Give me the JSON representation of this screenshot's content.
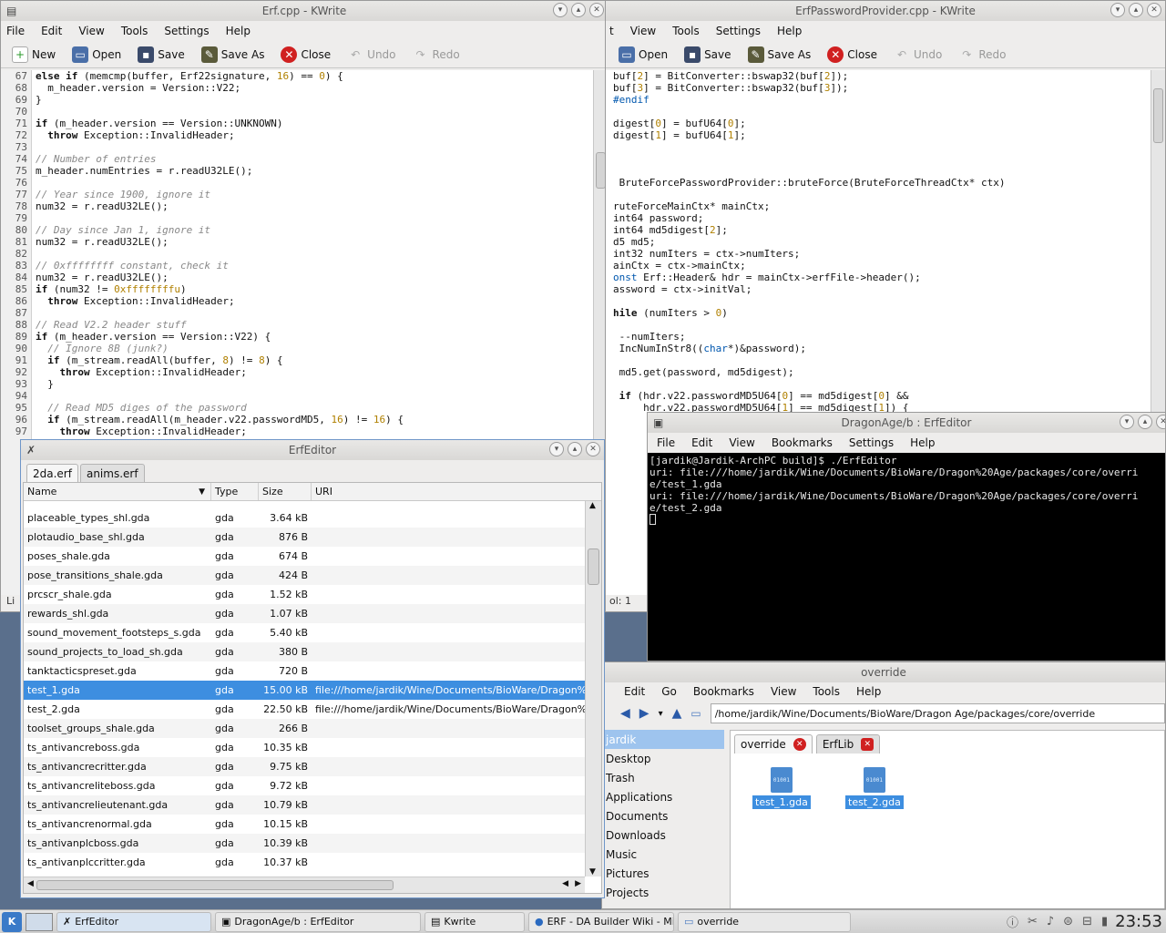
{
  "kwrite_left": {
    "title": "Erf.cpp  - KWrite",
    "menu": [
      "File",
      "Edit",
      "View",
      "Tools",
      "Settings",
      "Help"
    ],
    "toolbar": {
      "new": "New",
      "open": "Open",
      "save": "Save",
      "save_as": "Save As",
      "close": "Close",
      "undo": "Undo",
      "redo": "Redo"
    },
    "line_numbers": [
      "67",
      "68",
      "69",
      "70",
      "71",
      "72",
      "73",
      "74",
      "75",
      "76",
      "77",
      "78",
      "79",
      "80",
      "81",
      "82",
      "83",
      "84",
      "85",
      "86",
      "87",
      "88",
      "89",
      "90",
      "91",
      "92",
      "93",
      "94",
      "95",
      "96",
      "97"
    ],
    "status_prefix": "Li"
  },
  "kwrite_right": {
    "title": "ErfPasswordProvider.cpp  - KWrite",
    "menu": [
      "t",
      "View",
      "Tools",
      "Settings",
      "Help"
    ],
    "toolbar": {
      "open": "Open",
      "save": "Save",
      "save_as": "Save As",
      "close": "Close",
      "undo": "Undo",
      "redo": "Redo"
    },
    "status_col": "ol: 1"
  },
  "erfeditor": {
    "title": "ErfEditor",
    "tabs": [
      "2da.erf",
      "anims.erf"
    ],
    "columns": [
      "Name",
      "Type",
      "Size",
      "URI"
    ],
    "rows": [
      {
        "name": "placeable_types_shl.gda",
        "type": "gda",
        "size": "3.64 kB",
        "uri": ""
      },
      {
        "name": "plotaudio_base_shl.gda",
        "type": "gda",
        "size": "876 B",
        "uri": ""
      },
      {
        "name": "poses_shale.gda",
        "type": "gda",
        "size": "674 B",
        "uri": ""
      },
      {
        "name": "pose_transitions_shale.gda",
        "type": "gda",
        "size": "424 B",
        "uri": ""
      },
      {
        "name": "prcscr_shale.gda",
        "type": "gda",
        "size": "1.52 kB",
        "uri": ""
      },
      {
        "name": "rewards_shl.gda",
        "type": "gda",
        "size": "1.07 kB",
        "uri": ""
      },
      {
        "name": "sound_movement_footsteps_s.gda",
        "type": "gda",
        "size": "5.40 kB",
        "uri": ""
      },
      {
        "name": "sound_projects_to_load_sh.gda",
        "type": "gda",
        "size": "380 B",
        "uri": ""
      },
      {
        "name": "tanktacticspreset.gda",
        "type": "gda",
        "size": "720 B",
        "uri": ""
      },
      {
        "name": "test_1.gda",
        "type": "gda",
        "size": "15.00 kB",
        "uri": "file:///home/jardik/Wine/Documents/BioWare/Dragon%"
      },
      {
        "name": "test_2.gda",
        "type": "gda",
        "size": "22.50 kB",
        "uri": "file:///home/jardik/Wine/Documents/BioWare/Dragon%"
      },
      {
        "name": "toolset_groups_shale.gda",
        "type": "gda",
        "size": "266 B",
        "uri": ""
      },
      {
        "name": "ts_antivancreboss.gda",
        "type": "gda",
        "size": "10.35 kB",
        "uri": ""
      },
      {
        "name": "ts_antivancrecritter.gda",
        "type": "gda",
        "size": "9.75 kB",
        "uri": ""
      },
      {
        "name": "ts_antivancreliteboss.gda",
        "type": "gda",
        "size": "9.72 kB",
        "uri": ""
      },
      {
        "name": "ts_antivancrelieutenant.gda",
        "type": "gda",
        "size": "10.79 kB",
        "uri": ""
      },
      {
        "name": "ts_antivancrenormal.gda",
        "type": "gda",
        "size": "10.15 kB",
        "uri": ""
      },
      {
        "name": "ts_antivanplcboss.gda",
        "type": "gda",
        "size": "10.39 kB",
        "uri": ""
      },
      {
        "name": "ts_antivanplccritter.gda",
        "type": "gda",
        "size": "10.37 kB",
        "uri": ""
      }
    ],
    "selected_index": 9
  },
  "terminal": {
    "title": "DragonAge/b : ErfEditor",
    "menu": [
      "File",
      "Edit",
      "View",
      "Bookmarks",
      "Settings",
      "Help"
    ],
    "lines": [
      "[jardik@Jardik-ArchPC build]$ ./ErfEditor",
      "uri: file:///home/jardik/Wine/Documents/BioWare/Dragon%20Age/packages/core/overri",
      "e/test_1.gda",
      "uri: file:///home/jardik/Wine/Documents/BioWare/Dragon%20Age/packages/core/overri",
      "e/test_2.gda"
    ]
  },
  "dolphin": {
    "title": "override",
    "menu": [
      "Edit",
      "Go",
      "Bookmarks",
      "View",
      "Tools",
      "Help"
    ],
    "path": "/home/jardik/Wine/Documents/BioWare/Dragon Age/packages/core/override",
    "places": [
      "jardik",
      "Desktop",
      "Trash",
      "Applications",
      "Documents",
      "Downloads",
      "Music",
      "Pictures",
      "Projects"
    ],
    "tabs": [
      "override",
      "ErfLib"
    ],
    "files": [
      "test_1.gda",
      "test_2.gda"
    ]
  },
  "taskbar": {
    "tasks": [
      "ErfEditor",
      "DragonAge/b : ErfEditor",
      "Kwrite",
      "ERF - DA Builder Wiki - Mi",
      "override"
    ],
    "clock": "23:53"
  }
}
